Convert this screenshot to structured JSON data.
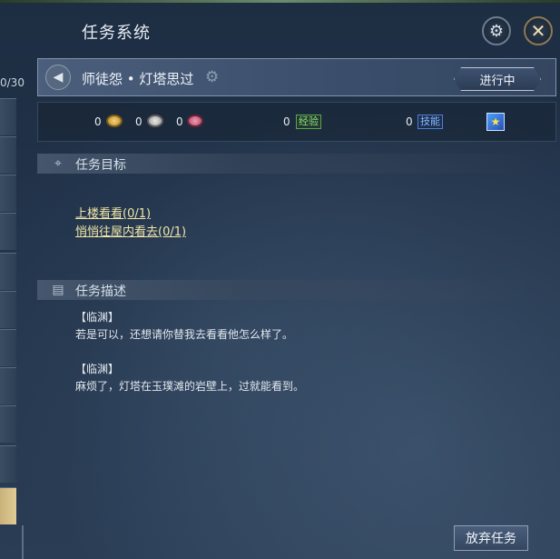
{
  "window": {
    "title": "任务系统"
  },
  "left_list": {
    "count_text": "0/30"
  },
  "quest": {
    "name": "师徒怨 • 灯塔思过",
    "status": "进行中"
  },
  "rewards": {
    "gold": "0",
    "silver": "0",
    "jade": "0",
    "exp_value": "0",
    "exp_label": "经验",
    "skill_value": "0",
    "skill_label": "技能"
  },
  "objectives": {
    "title": "任务目标",
    "items": [
      "上楼看看(0/1)",
      "悄悄往屋内看去(0/1)"
    ]
  },
  "description": {
    "title": "任务描述",
    "lines": [
      "【临渊】",
      "若是可以，还想请你替我去看看他怎么样了。",
      "【临渊】",
      "麻烦了，灯塔在玉璞滩的岩壁上，过就能看到。"
    ]
  },
  "buttons": {
    "abandon": "放弃任务"
  },
  "icons": {
    "settings": "gear-icon",
    "close": "close-icon",
    "speaker": "speaker-icon",
    "location": "location-pin-icon",
    "scroll": "scroll-icon"
  },
  "colors": {
    "objective_text": "#f1e6a6",
    "exp_tag": "#8fe079",
    "skill_tag": "#88b9ff"
  }
}
